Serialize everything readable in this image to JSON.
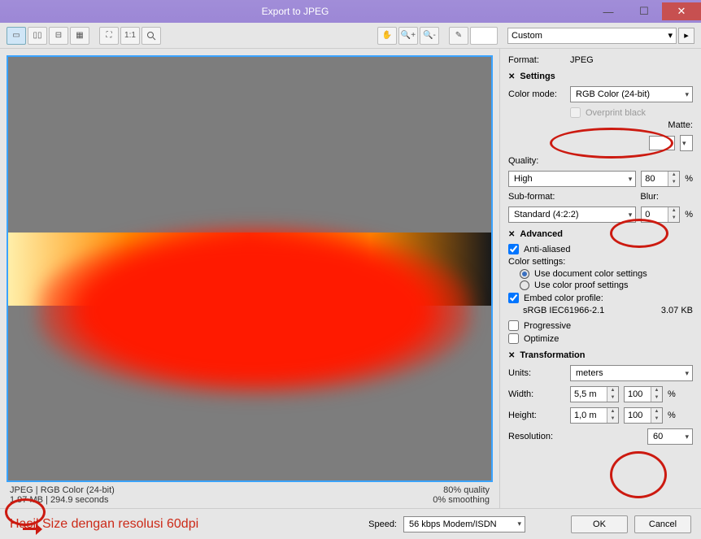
{
  "window": {
    "title": "Export to JPEG"
  },
  "preset": {
    "value": "Custom"
  },
  "format": {
    "label": "Format:",
    "value": "JPEG"
  },
  "settings": {
    "header": "Settings",
    "color_mode_label": "Color mode:",
    "color_mode_value": "RGB Color (24-bit)",
    "overprint_label": "Overprint black",
    "matte_label": "Matte:",
    "quality_label": "Quality:",
    "quality_preset": "High",
    "quality_value": "80",
    "pct": "%",
    "subformat_label": "Sub-format:",
    "subformat_value": "Standard (4:2:2)",
    "blur_label": "Blur:",
    "blur_value": "0"
  },
  "advanced": {
    "header": "Advanced",
    "anti_aliased": "Anti-aliased",
    "color_settings": "Color settings:",
    "use_doc": "Use document color settings",
    "use_proof": "Use color proof settings",
    "embed_profile": "Embed color profile:",
    "profile_name": "sRGB IEC61966-2.1",
    "profile_size": "3.07 KB",
    "progressive": "Progressive",
    "optimize": "Optimize"
  },
  "transform": {
    "header": "Transformation",
    "units_label": "Units:",
    "units_value": "meters",
    "width_label": "Width:",
    "width_value": "5,5 m",
    "width_pct": "100",
    "height_label": "Height:",
    "height_value": "1,0 m",
    "height_pct": "100",
    "pct": "%",
    "resolution_label": "Resolution:",
    "resolution_value": "60"
  },
  "info": {
    "line1a": "JPEG",
    "line1b": "RGB Color (24-bit)",
    "line2a": "1.97 MB",
    "line2b": "294.9 seconds",
    "quality": "80% quality",
    "smoothing": "0% smoothing",
    "sep": " | "
  },
  "footer": {
    "annotation": "Hasil Size dengan resolusi 60dpi",
    "speed_label": "Speed:",
    "speed_value": "56 kbps Modem/ISDN",
    "ok": "OK",
    "cancel": "Cancel"
  }
}
